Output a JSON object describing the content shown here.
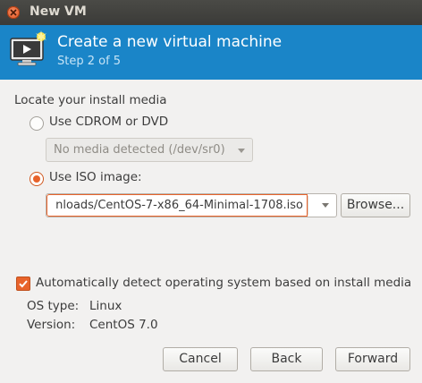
{
  "window": {
    "title": "New VM"
  },
  "header": {
    "title": "Create a new virtual machine",
    "step": "Step 2 of 5"
  },
  "section": {
    "heading": "Locate your install media"
  },
  "cdrom": {
    "label": "Use CDROM or DVD",
    "selected": false,
    "media_value": "No media detected (/dev/sr0)"
  },
  "iso": {
    "label": "Use ISO image:",
    "selected": true,
    "path_value": "nloads/CentOS-7-x86_64-Minimal-1708.iso",
    "browse_label": "Browse..."
  },
  "detect": {
    "label": "Automatically detect operating system based on install media",
    "checked": true,
    "os_type_label": "OS type:",
    "os_type_value": "Linux",
    "version_label": "Version:",
    "version_value": "CentOS 7.0"
  },
  "buttons": {
    "cancel": "Cancel",
    "back": "Back",
    "forward": "Forward"
  },
  "icons": {
    "close": "close-icon",
    "vm": "vm-monitor-icon"
  },
  "colors": {
    "header_bg": "#1a85c8",
    "accent": "#e8632b",
    "titlebar_bg": "#3e3e3b"
  }
}
